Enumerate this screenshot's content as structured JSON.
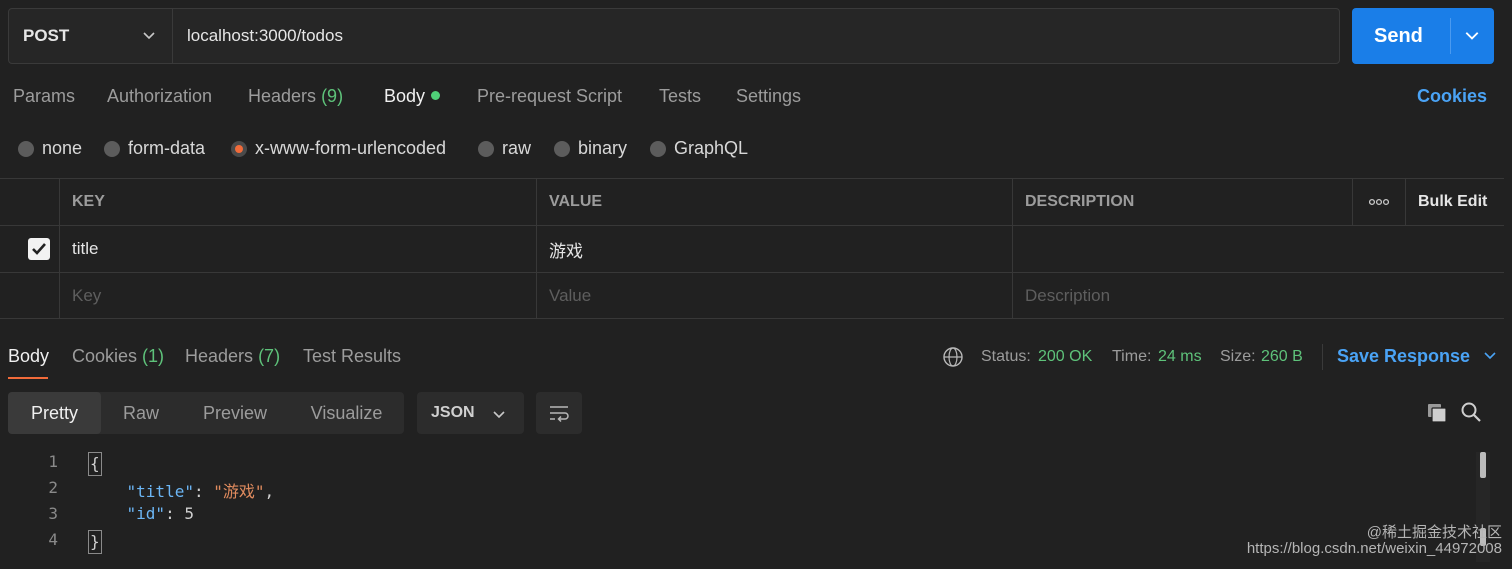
{
  "request": {
    "method": "POST",
    "url": "localhost:3000/todos",
    "send_label": "Send"
  },
  "tabs": [
    {
      "label": "Params"
    },
    {
      "label": "Authorization"
    },
    {
      "label": "Headers",
      "count": "(9)"
    },
    {
      "label": "Body",
      "active": true
    },
    {
      "label": "Pre-request Script"
    },
    {
      "label": "Tests"
    },
    {
      "label": "Settings"
    }
  ],
  "cookies_label": "Cookies",
  "body_types": [
    "none",
    "form-data",
    "x-www-form-urlencoded",
    "raw",
    "binary",
    "GraphQL"
  ],
  "selected_body_type": "x-www-form-urlencoded",
  "kv_table": {
    "headers": {
      "key": "KEY",
      "value": "VALUE",
      "description": "DESCRIPTION",
      "more": "ooo",
      "bulk_edit": "Bulk Edit"
    },
    "rows": [
      {
        "checked": true,
        "key": "title",
        "value": "游戏",
        "description": ""
      }
    ],
    "placeholders": {
      "key": "Key",
      "value": "Value",
      "description": "Description"
    }
  },
  "response": {
    "tabs": [
      {
        "label": "Body",
        "active": true
      },
      {
        "label": "Cookies",
        "count": "(1)"
      },
      {
        "label": "Headers",
        "count": "(7)"
      },
      {
        "label": "Test Results"
      }
    ],
    "status_label": "Status:",
    "status_value": "200 OK",
    "time_label": "Time:",
    "time_value": "24 ms",
    "size_label": "Size:",
    "size_value": "260 B",
    "save_label": "Save Response",
    "views": [
      "Pretty",
      "Raw",
      "Preview",
      "Visualize"
    ],
    "format": "JSON",
    "code": {
      "line_numbers": [
        "1",
        "2",
        "3",
        "4"
      ],
      "open_brace": "{",
      "close_brace": "}",
      "title_key": "\"title\"",
      "title_value": "\"游戏\"",
      "id_key": "\"id\"",
      "id_value": "5"
    }
  },
  "watermark": {
    "line1": "@稀土掘金技术社区",
    "line2": "https://blog.csdn.net/weixin_44972008"
  },
  "colors": {
    "accent_blue": "#1a7ee8",
    "link_blue": "#4aa3f5",
    "success_green": "#5ec27a",
    "active_orange": "#f26b3a"
  }
}
